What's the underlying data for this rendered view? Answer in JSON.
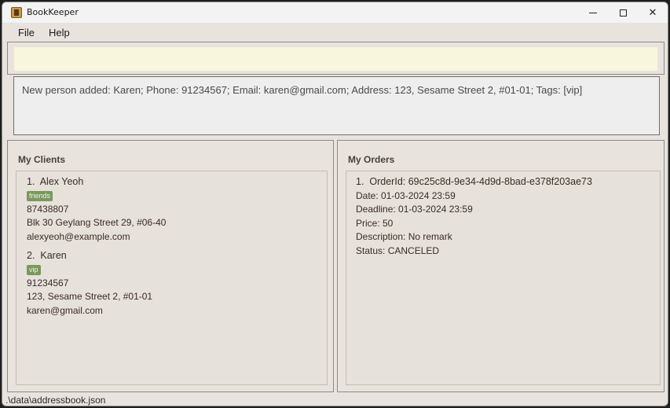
{
  "window": {
    "title": "BookKeeper"
  },
  "menu": {
    "items": [
      "File",
      "Help"
    ]
  },
  "command": {
    "value": ""
  },
  "result": {
    "text": "New person added: Karen; Phone: 91234567; Email: karen@gmail.com; Address: 123, Sesame Street 2, #01-01; Tags: [vip]"
  },
  "clients": {
    "title": "My Clients",
    "items": [
      {
        "index": "1.",
        "name": "Alex Yeoh",
        "tag": "friends",
        "phone": "87438807",
        "address": "Blk 30 Geylang Street 29, #06-40",
        "email": "alexyeoh@example.com"
      },
      {
        "index": "2.",
        "name": "Karen",
        "tag": "vip",
        "phone": "91234567",
        "address": "123, Sesame Street 2, #01-01",
        "email": "karen@gmail.com"
      }
    ]
  },
  "orders": {
    "title": "My Orders",
    "items": [
      {
        "index": "1.",
        "order_id": "OrderId: 69c25c8d-9e34-4d9d-8bad-e378f203ae73",
        "date": "Date: 01-03-2024 23:59",
        "deadline": "Deadline: 01-03-2024 23:59",
        "price": "Price: 50",
        "description": "Description: No remark",
        "status": "Status: CANCELED"
      }
    ]
  },
  "status": {
    "path": ".\\data\\addressbook.json"
  },
  "colors": {
    "command_bg": "#f8f6dc",
    "tag_bg": "#79985a",
    "window_bg": "#e8e3dd"
  }
}
